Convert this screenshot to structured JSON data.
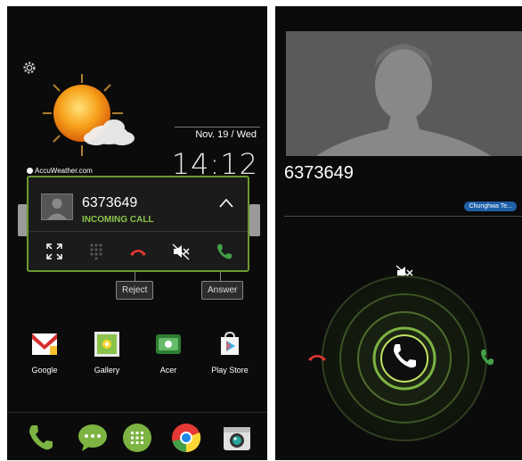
{
  "lock": {
    "weather_source": "AccuWeather.com",
    "date": "Nov. 19 / Wed",
    "time": "14:12"
  },
  "call_card": {
    "number": "6373649",
    "status": "INCOMING CALL"
  },
  "tooltips": {
    "reject": "Reject",
    "answer": "Answer"
  },
  "apps": [
    {
      "label": "Google",
      "icon": "google-folder-icon"
    },
    {
      "label": "Gallery",
      "icon": "gallery-icon"
    },
    {
      "label": "Acer",
      "icon": "acer-folder-icon"
    },
    {
      "label": "Play Store",
      "icon": "play-store-icon"
    }
  ],
  "dock": [
    "phone-icon",
    "messaging-icon",
    "app-drawer-icon",
    "chrome-icon",
    "camera-icon"
  ],
  "incoming": {
    "number": "6373649",
    "carrier": "Chunghwa Te..."
  },
  "colors": {
    "accent_green": "#8bc34a",
    "reject_red": "#e53935",
    "carrier_blue": "#1e5fa8"
  }
}
